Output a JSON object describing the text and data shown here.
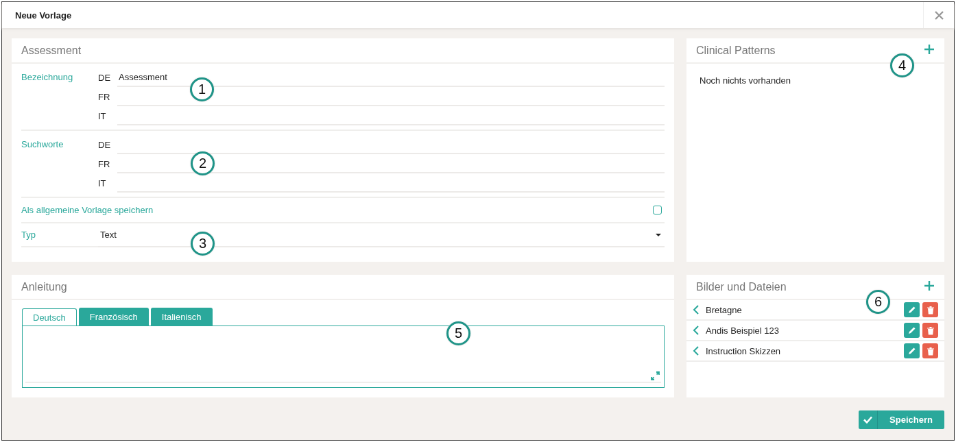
{
  "window": {
    "title": "Neue Vorlage"
  },
  "assessment": {
    "title": "Assessment",
    "groups": [
      {
        "label": "Bezeichnung",
        "fields": [
          {
            "lang": "DE",
            "value": "Assessment"
          },
          {
            "lang": "FR"
          },
          {
            "lang": "IT"
          }
        ]
      },
      {
        "label": "Suchworte",
        "fields": [
          {
            "lang": "DE"
          },
          {
            "lang": "FR"
          },
          {
            "lang": "IT"
          }
        ]
      }
    ],
    "general_template": {
      "label": "Als allgemeine Vorlage speichern",
      "checked": false
    },
    "type": {
      "label": "Typ",
      "value": "Text"
    }
  },
  "clinical_patterns": {
    "title": "Clinical Patterns",
    "empty_text": "Noch nichts vorhanden"
  },
  "instructions": {
    "title": "Anleitung",
    "tabs": [
      {
        "label": "Deutsch",
        "selected": true
      },
      {
        "label": "Französisch",
        "selected": false
      },
      {
        "label": "Italienisch",
        "selected": false
      }
    ]
  },
  "files": {
    "title": "Bilder und Dateien",
    "items": [
      {
        "name": "Bretagne"
      },
      {
        "name": "Andis Beispiel 123"
      },
      {
        "name": "Instruction Skizzen"
      }
    ]
  },
  "save_button": "Speichern",
  "callouts": [
    "1",
    "2",
    "3",
    "4",
    "5",
    "6"
  ]
}
